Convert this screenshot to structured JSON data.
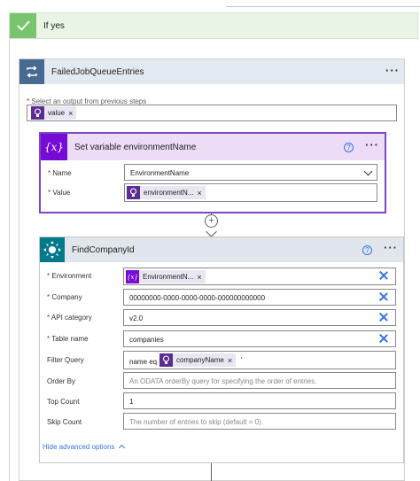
{
  "condition": {
    "branch_label": "If yes"
  },
  "foreach": {
    "title": "FailedJobQueueEntries",
    "select_label": "Select an output from previous steps",
    "select_token": "value",
    "token_remove": "×"
  },
  "set_variable": {
    "title": "Set variable environmentName",
    "icon_text": "{x}",
    "name_label": "Name",
    "name_value": "EnvironmentName",
    "value_label": "Value",
    "value_token": "environmentN...",
    "token_remove": "×"
  },
  "connector": {
    "plus": "+"
  },
  "find_company": {
    "title": "FindCompanyId",
    "fields": {
      "environment": {
        "label": "Environment",
        "token": "EnvironmentN...",
        "token_icon": "{x}"
      },
      "company": {
        "label": "Company",
        "value": "00000000-0000-0000-0000-000000000000"
      },
      "api_category": {
        "label": "API category",
        "value": "v2.0"
      },
      "table_name": {
        "label": "Table name",
        "value": "companies"
      },
      "filter_query": {
        "label": "Filter Query",
        "prefix": "name eq '",
        "token": "companyName",
        "suffix": "'"
      },
      "order_by": {
        "label": "Order By",
        "placeholder": "An ODATA orderBy query for specifying the order of entries."
      },
      "top_count": {
        "label": "Top Count",
        "value": "1"
      },
      "skip_count": {
        "label": "Skip Count",
        "placeholder": "The number of entries to skip (default = 0)."
      }
    },
    "hide_advanced": "Hide advanced options"
  },
  "common": {
    "required_mark": "*",
    "help": "?",
    "more": "···",
    "x": "×"
  },
  "colors": {
    "accent": "#3a74d8",
    "variable_purple": "#770bd6",
    "token_purple": "#5c2d91",
    "condition_green": "#79c46e",
    "foreach_blue": "#486991",
    "dataverse_teal": "#007a8a"
  }
}
